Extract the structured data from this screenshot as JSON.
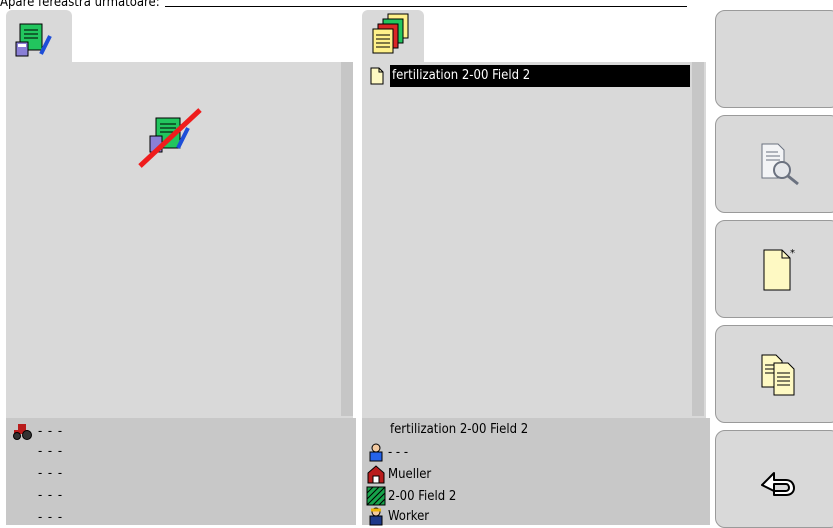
{
  "caption": "Apare fereastra următoare:",
  "left_pane": {
    "info_rows": [
      "- - -",
      "- - -",
      "- - -",
      "- - -",
      "- - -"
    ]
  },
  "middle_pane": {
    "list_items": [
      {
        "label": "fertilization 2-00 Field 2",
        "selected": true
      }
    ],
    "info": {
      "title": "fertilization 2-00 Field 2",
      "person": "- - -",
      "farm": "Mueller",
      "field": "2-00 Field 2",
      "worker": "Worker"
    }
  },
  "softkeys": [
    {
      "icon": "empty"
    },
    {
      "icon": "document-search-icon"
    },
    {
      "icon": "new-document-icon"
    },
    {
      "icon": "copy-documents-icon"
    },
    {
      "icon": "back-arrow-icon"
    }
  ]
}
